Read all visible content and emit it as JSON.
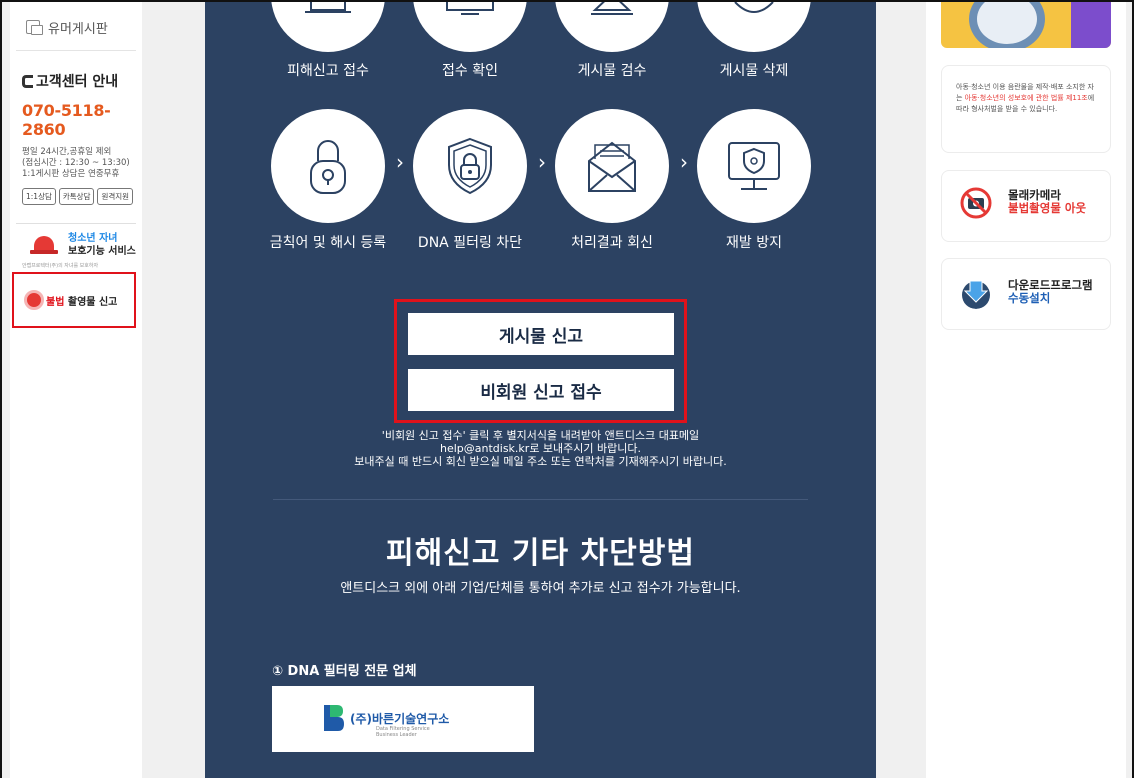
{
  "left_sidebar": {
    "board_link": "유머게시판",
    "cs_title": "고객센터 안내",
    "cs_phone": "070-5118-2860",
    "cs_hours": [
      "평일 24시간,공휴일 제외",
      "(점심시간 : 12:30 ~ 13:30)",
      "1:1게시판 상담은 연중무휴"
    ],
    "cs_buttons": [
      "1:1상담",
      "카톡상담",
      "원격지원"
    ],
    "youth_banner": {
      "line1": "청소년 자녀",
      "line2": "보호기능 서비스",
      "small": "안랩프로텍터(주)의 자녀를 보호하자"
    },
    "illegal_banner": {
      "red": "불법",
      "rest": " 촬영물 신고"
    }
  },
  "main": {
    "steps_top": [
      "피해신고 접수",
      "접수 확인",
      "게시물 검수",
      "게시물 삭제"
    ],
    "steps_bottom": [
      "금칙어 및 해시 등록",
      "DNA 필터링 차단",
      "처리결과 회신",
      "재발 방지"
    ],
    "chevron": "›",
    "report_post_button": "게시물 신고",
    "nonmember_report_button": "비회원 신고 접수",
    "notice_lines": [
      "'비회원 신고 접수' 클릭 후 별지서식을 내려받아 앤트디스크 대표메일",
      "help@antdisk.kr로 보내주시기 바랍니다.",
      "보내주실 때 반드시 회신 받으실 메일 주소 또는 연락처를 기재해주시기 바랍니다."
    ],
    "section_title": "피해신고 기타 차단방법",
    "section_sub": "앤트디스크 외에 아래 기업/단체를 통하여 추가로 신고 접수가 가능합니다.",
    "dna_heading": "① DNA 필터링 전문 업체",
    "partner": {
      "name": "(주)바른기술연구소",
      "sub1": "Data Filtering Service",
      "sub2": "Business Leader"
    }
  },
  "right_sidebar": {
    "legal_notice": {
      "part1": "아동·청소년 이용 음란물을 제작·배포 소지한 자는 ",
      "red1": "아동·청소년의 성보호에 관한 법률 제11조",
      "part2": "에 따라 형사처벌을 받을 수 있습니다."
    },
    "camera_banner": {
      "line1": "몰래카메라",
      "line2": "불법촬영물 아웃"
    },
    "download_banner": {
      "line1": "다운로드프로그램",
      "line2": "수동설치"
    }
  },
  "colors": {
    "panel_bg": "#2c4262",
    "accent_red": "#e0121b",
    "phone_orange": "#e55a1f",
    "link_blue": "#1e5fb5"
  }
}
